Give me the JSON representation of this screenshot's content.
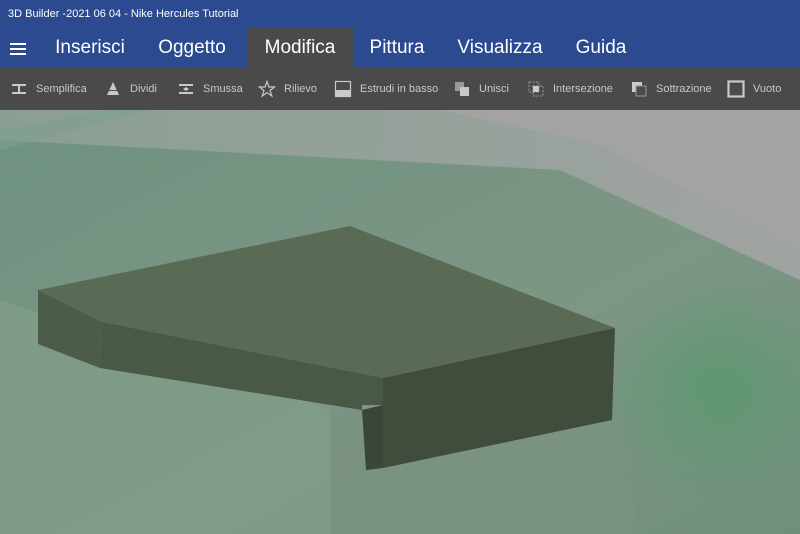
{
  "window": {
    "title": "3D Builder -2021 06 04 - Nike Hercules Tutorial"
  },
  "menu": {
    "hamburger_icon": "hamburger-icon",
    "tabs": [
      {
        "label": "Inserisci"
      },
      {
        "label": "Oggetto"
      },
      {
        "label": "Modifica",
        "active": true
      },
      {
        "label": "Pittura"
      },
      {
        "label": "Visualizza"
      },
      {
        "label": "Guida"
      }
    ]
  },
  "toolbar": {
    "items": [
      {
        "label": "Semplifica",
        "icon": "simplify-icon"
      },
      {
        "label": "Dividi",
        "icon": "split-icon"
      },
      {
        "label": "Smussa",
        "icon": "smooth-icon"
      },
      {
        "label": "Rilievo",
        "icon": "emboss-star-icon"
      },
      {
        "label": "Estrudi in basso",
        "icon": "extrude-down-icon"
      },
      {
        "label": "Unisci",
        "icon": "merge-icon"
      },
      {
        "label": "Intersezione",
        "icon": "intersect-icon"
      },
      {
        "label": "Sottrazione",
        "icon": "subtract-icon"
      },
      {
        "label": "Vuoto",
        "icon": "hollow-icon"
      }
    ]
  },
  "colors": {
    "titlebar": "#2b4a8f",
    "toolbar": "#4a4a4a",
    "active_tab": "#4a4a4a",
    "toolbar_text": "#c9c9c9",
    "model_top": "#5b6a54",
    "model_front": "#4a5846",
    "model_side": "#3f4b3b",
    "ground": "#7d9685"
  }
}
